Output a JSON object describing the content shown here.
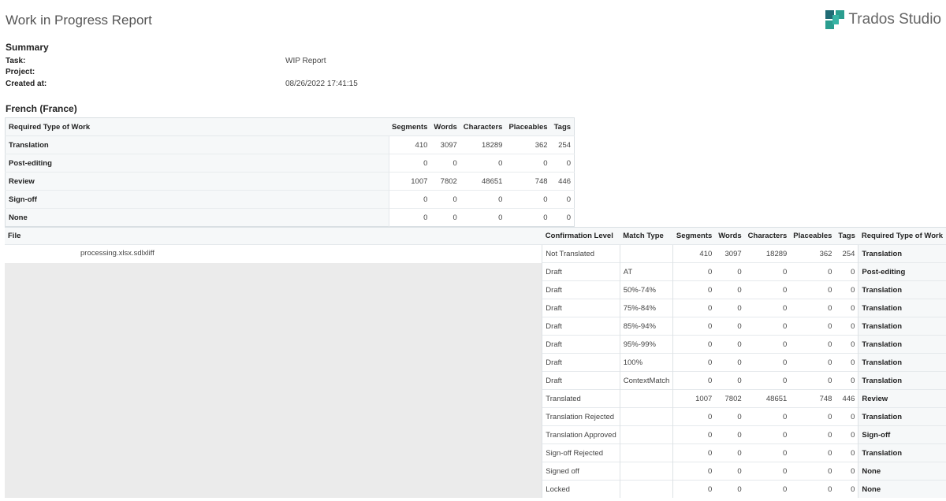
{
  "header": {
    "title": "Work in Progress Report",
    "brand": "Trados Studio",
    "brand_colors": [
      "#2a9d8f",
      "#1f6b74"
    ]
  },
  "summary": {
    "heading": "Summary",
    "task_label": "Task:",
    "task_value": "WIP Report",
    "project_label": "Project:",
    "project_value": "",
    "created_label": "Created at:",
    "created_value": "08/26/2022 17:41:15"
  },
  "language": "French (France)",
  "work_summary": {
    "columns": [
      "Required Type of Work",
      "Segments",
      "Words",
      "Characters",
      "Placeables",
      "Tags"
    ],
    "rows": [
      [
        "Translation",
        "410",
        "3097",
        "18289",
        "362",
        "254"
      ],
      [
        "Post-editing",
        "0",
        "0",
        "0",
        "0",
        "0"
      ],
      [
        "Review",
        "1007",
        "7802",
        "48651",
        "748",
        "446"
      ],
      [
        "Sign-off",
        "0",
        "0",
        "0",
        "0",
        "0"
      ],
      [
        "None",
        "0",
        "0",
        "0",
        "0",
        "0"
      ]
    ]
  },
  "file_table": {
    "columns": [
      "File",
      "Confirmation Level",
      "Match Type",
      "Segments",
      "Words",
      "Characters",
      "Placeables",
      "Tags",
      "Required Type of Work"
    ],
    "file_name": "processing.xlsx.sdlxliff",
    "rows": [
      [
        "Not Translated",
        "",
        "410",
        "3097",
        "18289",
        "362",
        "254",
        "Translation"
      ],
      [
        "Draft",
        "AT",
        "0",
        "0",
        "0",
        "0",
        "0",
        "Post-editing"
      ],
      [
        "Draft",
        "50%-74%",
        "0",
        "0",
        "0",
        "0",
        "0",
        "Translation"
      ],
      [
        "Draft",
        "75%-84%",
        "0",
        "0",
        "0",
        "0",
        "0",
        "Translation"
      ],
      [
        "Draft",
        "85%-94%",
        "0",
        "0",
        "0",
        "0",
        "0",
        "Translation"
      ],
      [
        "Draft",
        "95%-99%",
        "0",
        "0",
        "0",
        "0",
        "0",
        "Translation"
      ],
      [
        "Draft",
        "100%",
        "0",
        "0",
        "0",
        "0",
        "0",
        "Translation"
      ],
      [
        "Draft",
        "ContextMatch",
        "0",
        "0",
        "0",
        "0",
        "0",
        "Translation"
      ],
      [
        "Translated",
        "",
        "1007",
        "7802",
        "48651",
        "748",
        "446",
        "Review"
      ],
      [
        "Translation Rejected",
        "",
        "0",
        "0",
        "0",
        "0",
        "0",
        "Translation"
      ],
      [
        "Translation Approved",
        "",
        "0",
        "0",
        "0",
        "0",
        "0",
        "Sign-off"
      ],
      [
        "Sign-off Rejected",
        "",
        "0",
        "0",
        "0",
        "0",
        "0",
        "Translation"
      ],
      [
        "Signed off",
        "",
        "0",
        "0",
        "0",
        "0",
        "0",
        "None"
      ],
      [
        "Locked",
        "",
        "0",
        "0",
        "0",
        "0",
        "0",
        "None"
      ]
    ]
  }
}
